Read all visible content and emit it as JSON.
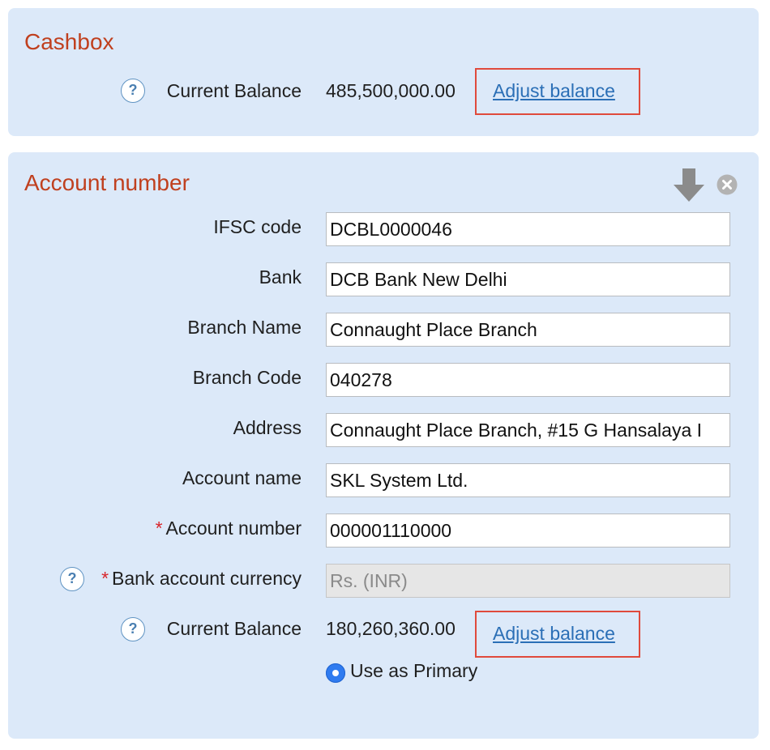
{
  "cashbox": {
    "title": "Cashbox",
    "help_icon": "?",
    "balance_label": "Current Balance",
    "balance_value": "485,500,000.00",
    "adjust_label": "Adjust balance"
  },
  "account": {
    "title": "Account number",
    "icons": {
      "download": "download-arrow-icon",
      "close": "close-circle-icon"
    },
    "fields": [
      {
        "label": "IFSC code",
        "value": "DCBL0000046"
      },
      {
        "label": "Bank",
        "value": "DCB Bank New Delhi"
      },
      {
        "label": "Branch Name",
        "value": "Connaught Place Branch"
      },
      {
        "label": "Branch Code",
        "value": "040278"
      },
      {
        "label": "Address",
        "value": "Connaught Place Branch, #15 G Hansalaya I"
      },
      {
        "label": "Account name",
        "value": "SKL System Ltd."
      },
      {
        "label": "Account number",
        "value": "000001110000",
        "required": true
      },
      {
        "label": "Bank account currency",
        "value": "Rs. (INR)",
        "required": true,
        "disabled": true
      }
    ],
    "required_mark": "*",
    "help_icon": "?",
    "balance_label": "Current Balance",
    "balance_value": "180,260,360.00",
    "adjust_label": "Adjust balance",
    "primary_label": "Use as Primary",
    "primary_selected": true
  },
  "colors": {
    "panel_bg": "#dce9f9",
    "title": "#c0401f",
    "link": "#2b6fb6",
    "highlight_box": "#e04a3c",
    "radio": "#2f7bf0"
  }
}
